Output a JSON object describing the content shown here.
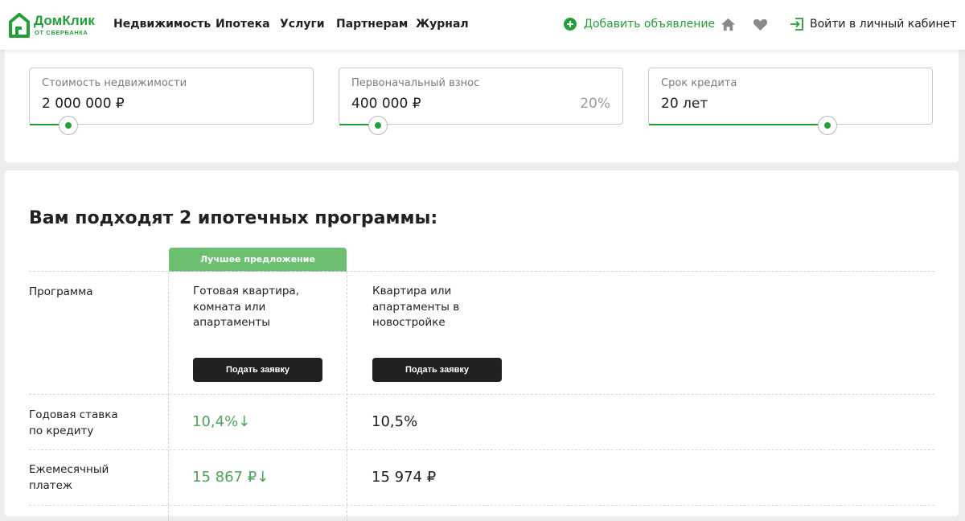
{
  "header": {
    "logo": {
      "name": "ДомКлик",
      "sub": "ОТ СБЕРБАНКА"
    },
    "nav": [
      "Недвижимость",
      "Ипотека",
      "Услуги",
      "Партнерам",
      "Журнал"
    ],
    "add_ad": "Добавить объявление",
    "icons": {
      "home": "home-icon",
      "favorites": "heart-icon",
      "login": "login-icon",
      "add": "plus-circle-icon"
    },
    "login": "Войти в личный кабинет"
  },
  "calculator": {
    "price": {
      "label": "Стоимость недвижимости",
      "value": "2 000 000 ₽",
      "slider_fraction": 0.1
    },
    "down_payment": {
      "label": "Первоначальный взнос",
      "value": "400 000 ₽",
      "percent": "20%",
      "slider_fraction": 0.1
    },
    "term": {
      "label": "Срок кредита",
      "value": "20 лет",
      "slider_fraction": 0.65
    }
  },
  "programs": {
    "title": "Вам подходят 2 ипотечных программы:",
    "best_badge": "Лучшее предложение",
    "row_labels": {
      "program": "Программа",
      "rate": "Годовая ставка по кредиту",
      "payment": "Ежемесячный платеж"
    },
    "items": [
      {
        "name": "Готовая квартира, комната или апартаменты",
        "button": "Подать заявку",
        "rate": "10,4%↓",
        "payment": "15 867 ₽↓"
      },
      {
        "name": "Квартира или апартаменты в новостройке",
        "button": "Подать заявку",
        "rate": "10,5%",
        "payment": "15 974 ₽"
      }
    ]
  },
  "colors": {
    "accent": "#21a038",
    "best": "#6cc070",
    "button": "#212121"
  }
}
